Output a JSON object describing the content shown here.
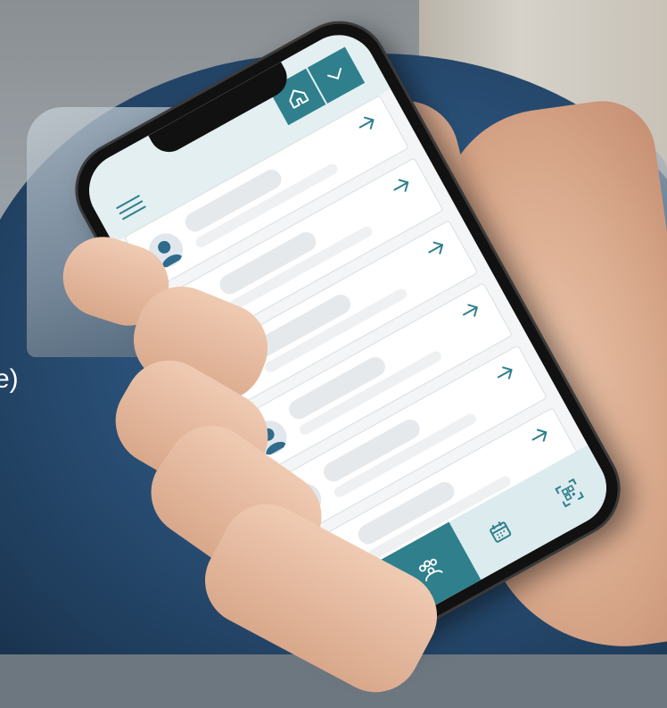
{
  "background": {
    "edge_text": "e)"
  },
  "colors": {
    "accent": "#2f7f8c",
    "header_bg": "#e3eff1",
    "tabbar_bg": "#dcebee",
    "card_bg": "#ffffff",
    "placeholder": "#e6e9ec",
    "avatar_fill": "#2f6b8a"
  },
  "app": {
    "header": {
      "menu_icon": "hamburger-icon",
      "home_icon": "home-icon",
      "dropdown_icon": "chevron-down-icon"
    },
    "list": {
      "row_count": 6,
      "row_avatar_icon": "user-avatar-icon",
      "row_arrow_icon": "arrow-right-icon"
    },
    "tabbar": {
      "tabs": [
        {
          "icon": "home-icon",
          "active": false
        },
        {
          "icon": "group-icon",
          "active": true
        },
        {
          "icon": "calendar-icon",
          "active": false
        },
        {
          "icon": "qr-scan-icon",
          "active": false
        }
      ]
    }
  }
}
